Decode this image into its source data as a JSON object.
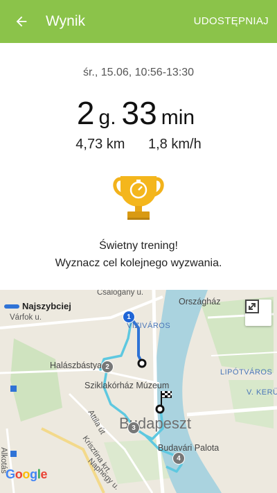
{
  "appbar": {
    "title": "Wynik",
    "share_label": "UDOSTĘPNIAJ",
    "back_icon": "arrow-left-icon"
  },
  "summary": {
    "date_time": "śr., 15.06, 10:56-13:30",
    "hours": "2",
    "hours_unit": "g.",
    "minutes": "33",
    "minutes_unit": "min",
    "distance": "4,73 km",
    "speed": "1,8 km/h"
  },
  "achievement": {
    "icon": "trophy-stopwatch-icon",
    "title": "Świetny trening!",
    "subtitle": "Wyznacz cel kolejnego wyzwania."
  },
  "map": {
    "legend_label": "Najszybciej",
    "expand_icon": "expand-icon",
    "attribution": [
      "G",
      "o",
      "o",
      "g",
      "l",
      "e"
    ],
    "labels": {
      "csalogany": "Csalogány u.",
      "orszaghaz": "Országház",
      "varfok": "Várfok u.",
      "vizivaros": "VÍZIVÁROS",
      "halaszbastya": "Halászbástya",
      "sziklakorhaz": "Sziklakórház Múzeum",
      "lipotvaros": "LIPÓTVÁROS",
      "kerulet": "V. KERÜL",
      "budapest": "Budapeszt",
      "budavari": "Budavári Palota",
      "attila": "Attila út",
      "krisztina": "Krisztina krt.",
      "naphegy": "Naphegy u.",
      "alkotas": "Alkotás"
    },
    "markers": [
      "1",
      "2",
      "3",
      "4"
    ],
    "colors": {
      "route_fast": "#2f73d6",
      "route": "#5ec8e0",
      "river": "#aad3df",
      "appbar": "#8bc34a"
    }
  }
}
